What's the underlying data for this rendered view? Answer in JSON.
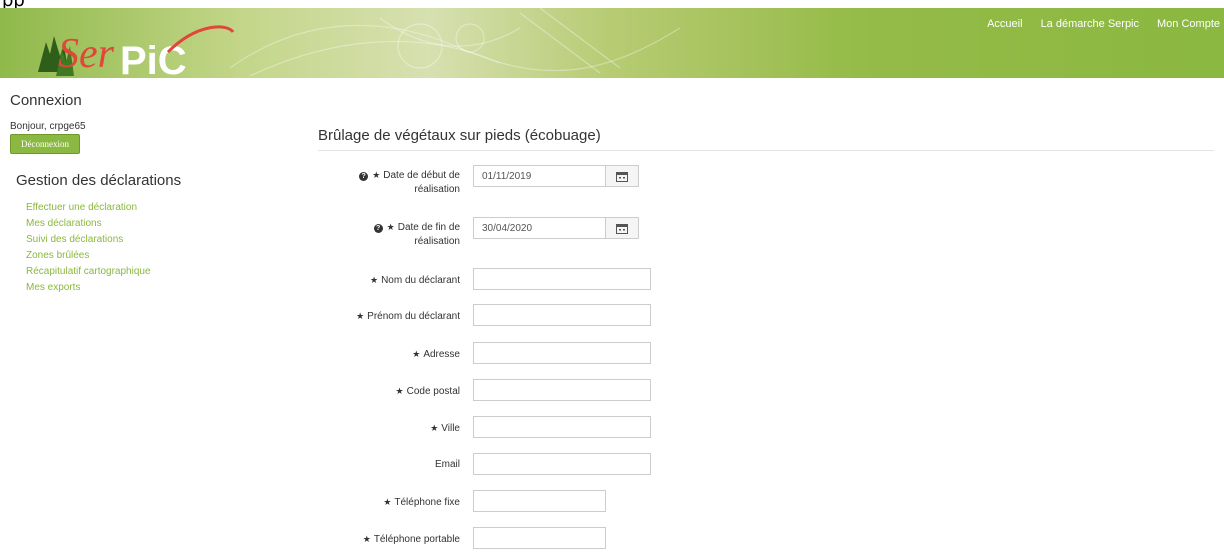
{
  "top": {
    "fragment": "pp"
  },
  "brand": {
    "logo_text": "SerPiC",
    "accent": "#8ab840"
  },
  "nav": [
    {
      "label": "Accueil"
    },
    {
      "label": "La démarche Serpic"
    },
    {
      "label": "Mon Compte"
    }
  ],
  "sidebar": {
    "login_title": "Connexion",
    "greeting": "Bonjour, crpge65",
    "logout_label": "Déconnexion",
    "gestion_title": "Gestion des déclarations",
    "links": [
      "Effectuer une déclaration",
      "Mes déclarations",
      "Suivi des déclarations",
      "Zones brûlées",
      "Récapitulatif cartographique",
      "Mes exports"
    ]
  },
  "form": {
    "title": "Brûlage de végétaux sur pieds (écobuage)",
    "date_start": {
      "label_line1": "Date de début de",
      "label_line2": "réalisation",
      "value": "01/11/2019"
    },
    "date_end": {
      "label_line1": "Date de fin de",
      "label_line2": "réalisation",
      "value": "30/04/2020"
    },
    "nom": {
      "label": "Nom du déclarant",
      "value": ""
    },
    "prenom": {
      "label": "Prénom du déclarant",
      "value": ""
    },
    "adresse": {
      "label": "Adresse",
      "value": ""
    },
    "code_postal": {
      "label": "Code postal",
      "value": ""
    },
    "ville": {
      "label": "Ville",
      "value": ""
    },
    "email": {
      "label": "Email",
      "value": ""
    },
    "tel_fixe": {
      "label": "Téléphone fixe",
      "value": ""
    },
    "tel_portable": {
      "label": "Téléphone portable",
      "value": ""
    }
  }
}
